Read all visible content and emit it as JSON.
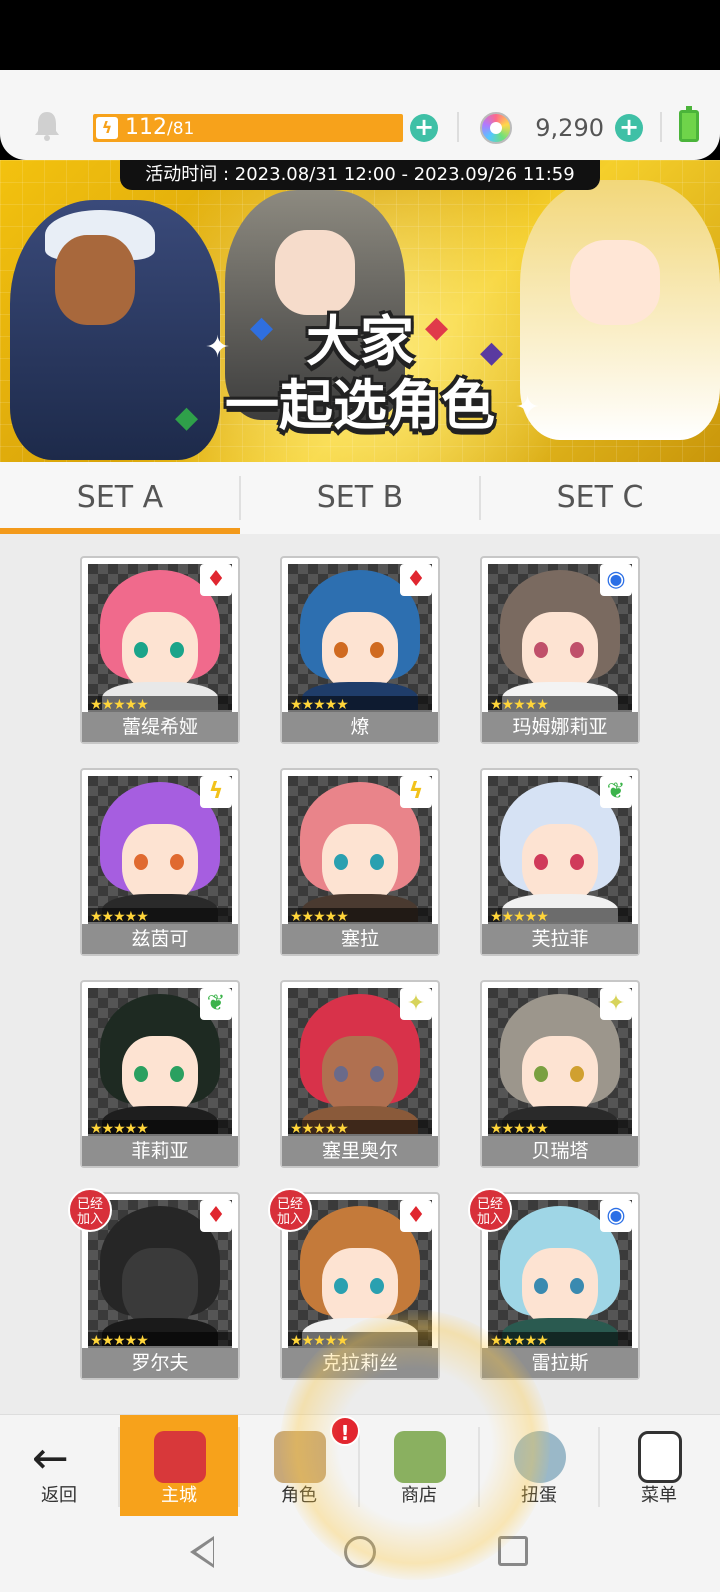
{
  "top_bar": {
    "energy_current": "112",
    "energy_max": "/81",
    "energy_icon": "lightning-icon",
    "gems": "9,290",
    "accent": "#f7a21b",
    "plus_color": "#3fc0a6"
  },
  "banner": {
    "event_time": "活动时间 : 2023.08/31 12:00 - 2023.09/26 11:59",
    "title_line1": "大家",
    "title_line2": "一起选角色"
  },
  "tabs": [
    {
      "label": "SET A",
      "active": true
    },
    {
      "label": "SET B",
      "active": false
    },
    {
      "label": "SET C",
      "active": false
    }
  ],
  "characters": [
    {
      "name": "蕾缇希娅",
      "element": "fire",
      "stars": 5,
      "joined": false
    },
    {
      "name": "燎",
      "element": "fire",
      "stars": 5,
      "joined": false
    },
    {
      "name": "玛姆娜莉亚",
      "element": "water",
      "stars": 5,
      "joined": false
    },
    {
      "name": "兹茵可",
      "element": "thunder",
      "stars": 5,
      "joined": false
    },
    {
      "name": "塞拉",
      "element": "thunder",
      "stars": 5,
      "joined": false
    },
    {
      "name": "芙拉菲",
      "element": "wind",
      "stars": 5,
      "joined": false
    },
    {
      "name": "菲莉亚",
      "element": "wind",
      "stars": 5,
      "joined": false
    },
    {
      "name": "塞里奥尔",
      "element": "light",
      "stars": 5,
      "joined": false
    },
    {
      "name": "贝瑞塔",
      "element": "light",
      "stars": 5,
      "joined": false
    },
    {
      "name": "罗尔夫",
      "element": "fire",
      "stars": 5,
      "joined": true
    },
    {
      "name": "克拉莉丝",
      "element": "fire",
      "stars": 5,
      "joined": true
    },
    {
      "name": "雷拉斯",
      "element": "water",
      "stars": 5,
      "joined": true
    }
  ],
  "joined_label": "已经加入",
  "stars_text": "★★★★★",
  "bottom_nav": [
    {
      "label": "返回",
      "icon": "back-arrow-icon"
    },
    {
      "label": "主城",
      "icon": "castle-icon",
      "active": true
    },
    {
      "label": "角色",
      "icon": "character-icon",
      "badge": "!"
    },
    {
      "label": "商店",
      "icon": "shop-icon"
    },
    {
      "label": "扭蛋",
      "icon": "gacha-icon"
    },
    {
      "label": "菜单",
      "icon": "menu-icon"
    }
  ]
}
